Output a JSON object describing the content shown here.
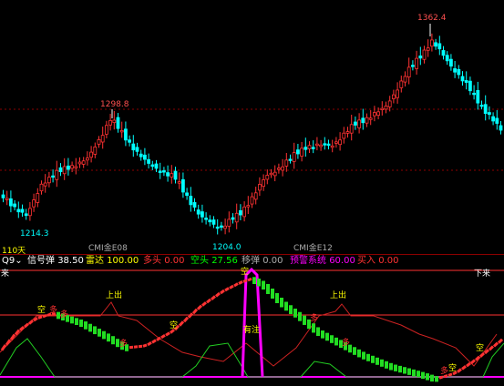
{
  "main_chart": {
    "annotations": {
      "high_1": "1298.8",
      "high_2": "1362.4",
      "low_1": "1214.3",
      "low_2": "1204.0"
    },
    "ma_labels": [
      "CMI金E08",
      "CMI金E12"
    ],
    "colors": {
      "up": "#ff3232",
      "down": "#00ffff",
      "grid": "#8b0000"
    }
  },
  "period_label": "110天",
  "indicator_bar": {
    "name": "Q9",
    "items": [
      {
        "label": "信号弹",
        "value": "38.50",
        "color": "#ffffff"
      },
      {
        "label": "雷达",
        "value": "100.00",
        "color": "#ffff00"
      },
      {
        "label": "多头",
        "value": "0.00",
        "color": "#ff3232"
      },
      {
        "label": "空头",
        "value": "27.56",
        "color": "#00ff00"
      },
      {
        "label": "移弹",
        "value": "0.00",
        "color": "#aaaaaa"
      },
      {
        "label": "预警系统",
        "value": "60.00",
        "color": "#ff00ff"
      },
      {
        "label": "买入",
        "value": "0.00",
        "color": "#ff3232"
      }
    ]
  },
  "sub_chart": {
    "top_left": "来",
    "top_right": "下来",
    "signals": [
      "上出",
      "上出",
      "有注"
    ],
    "kong": "空",
    "duo": "多"
  }
}
